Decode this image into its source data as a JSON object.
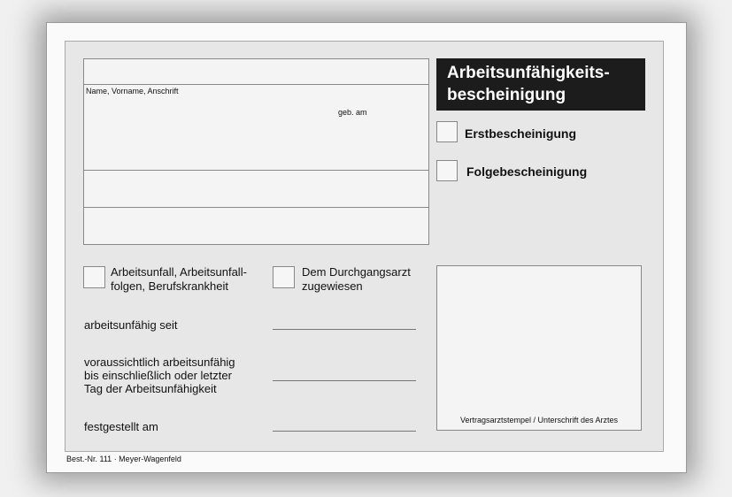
{
  "form": {
    "title_line1": "Arbeitsunfähigkeits-",
    "title_line2": "bescheinigung",
    "name_label": "Name, Vorname, Anschrift",
    "birth_label": "geb. am",
    "first_certificate": "Erstbescheinigung",
    "follow_certificate": "Folgebescheinigung",
    "accident_line1": "Arbeitsunfall, Arbeitsunfall-",
    "accident_line2": "folgen, Berufskrankheit",
    "transit_line1": "Dem Durchgangsarzt",
    "transit_line2": "zugewiesen",
    "unfit_since": "arbeitsunfähig seit",
    "expected_line1": "voraussichtlich arbeitsunfähig",
    "expected_line2": "bis einschließlich oder letzter",
    "expected_line3": "Tag der Arbeitsunfähigkeit",
    "determined_on": "festgestellt am",
    "stamp_label": "Vertragsarztstempel / Unterschrift des Arztes",
    "footer": "Best.-Nr. 111 · Meyer-Wagenfeld"
  }
}
